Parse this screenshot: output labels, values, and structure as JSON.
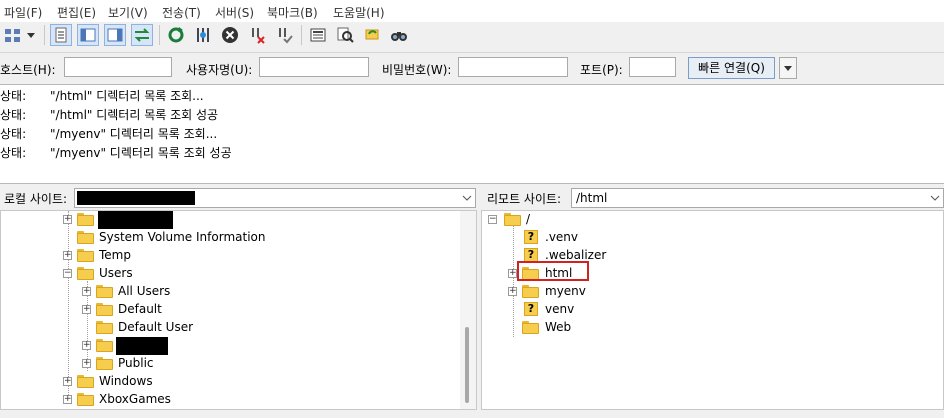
{
  "menu": [
    "파일(F)",
    "편집(E)",
    "보기(V)",
    "전송(T)",
    "서버(S)",
    "북마크(B)",
    "도움말(H)"
  ],
  "toolbar": {
    "icons": [
      "site-manager-icon",
      "dropdown-arrow-icon",
      "toggle-log-icon",
      "toggle-local-tree-icon",
      "toggle-remote-tree-icon",
      "toggle-queue-icon",
      "refresh-icon",
      "process-queue-icon",
      "cancel-icon",
      "disconnect-icon",
      "reconnect-icon",
      "filter-icon",
      "compare-icon",
      "sync-browse-icon",
      "search-icon"
    ]
  },
  "quickconnect": {
    "host_label": "호스트(H):",
    "user_label": "사용자명(U):",
    "pass_label": "비밀번호(W):",
    "port_label": "포트(P):",
    "host_value": "",
    "user_value": "",
    "pass_value": "",
    "port_value": "",
    "connect_label": "빠른 연결(Q)"
  },
  "log": [
    {
      "label": "상태:",
      "msg": "\"/html\" 디렉터리 목록 조회..."
    },
    {
      "label": "상태:",
      "msg": "\"/html\" 디렉터리 목록 조회 성공"
    },
    {
      "label": "상태:",
      "msg": "\"/myenv\" 디렉터리 목록 조회..."
    },
    {
      "label": "상태:",
      "msg": "\"/myenv\" 디렉터리 목록 조회 성공"
    }
  ],
  "local": {
    "label": "로컬 사이트:",
    "path": "",
    "tree": [
      {
        "label": "",
        "redacted": true
      },
      {
        "label": "System Volume Information"
      },
      {
        "label": "Temp"
      },
      {
        "label": "Users"
      },
      {
        "label": "All Users"
      },
      {
        "label": "Default"
      },
      {
        "label": "Default User"
      },
      {
        "label": "",
        "redacted": true
      },
      {
        "label": "Public"
      },
      {
        "label": "Windows"
      },
      {
        "label": "XboxGames"
      }
    ]
  },
  "remote": {
    "label": "리모트 사이트:",
    "path": "/html",
    "tree": [
      {
        "label": "/"
      },
      {
        "label": ".venv"
      },
      {
        "label": ".webalizer"
      },
      {
        "label": "html",
        "highlighted": true
      },
      {
        "label": "myenv"
      },
      {
        "label": "venv"
      },
      {
        "label": "Web"
      }
    ]
  },
  "colors": {
    "highlight": "#d32020",
    "folder": "#f6cd4d",
    "accent": "#7a9cc8"
  }
}
